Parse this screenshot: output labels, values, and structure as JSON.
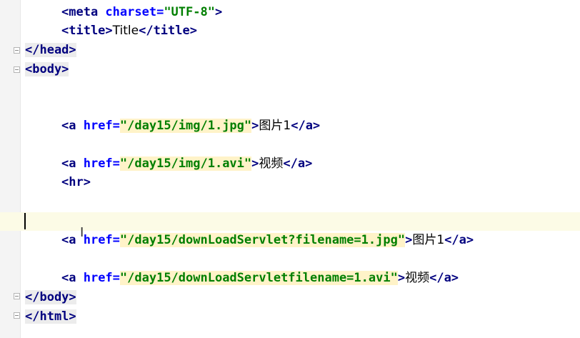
{
  "editor": {
    "lines": {
      "meta": {
        "open": "<meta ",
        "attr": "charset=",
        "val": "\"UTF-8\"",
        "close": ">"
      },
      "title": {
        "open": "<title>",
        "text": "Title",
        "close": "</title>"
      },
      "head_close": "</head>",
      "body_open": "<body>",
      "a1": {
        "open": "<a ",
        "attr": "href=",
        "val": "\"/day15/img/1.jpg\"",
        "gt": ">",
        "text": "图片1",
        "close": "</a>"
      },
      "a2": {
        "open": "<a ",
        "attr": "href=",
        "val": "\"/day15/img/1.avi\"",
        "gt": ">",
        "text": "视频",
        "close": "</a>"
      },
      "hr": "<hr>",
      "a3": {
        "open": "<a ",
        "attr": "href=",
        "val": "\"/day15/downLoadServlet?filename=1.jpg\"",
        "gt": ">",
        "text": "图片1",
        "close": "</a>"
      },
      "a4": {
        "open": "<a ",
        "attr": "href=",
        "val": "\"/day15/downLoadServletfilename=1.avi\"",
        "gt": ">",
        "text": "视频",
        "close": "</a>"
      },
      "body_close": "</body>",
      "html_close": "</html>"
    },
    "cursor_glyph": "I"
  }
}
